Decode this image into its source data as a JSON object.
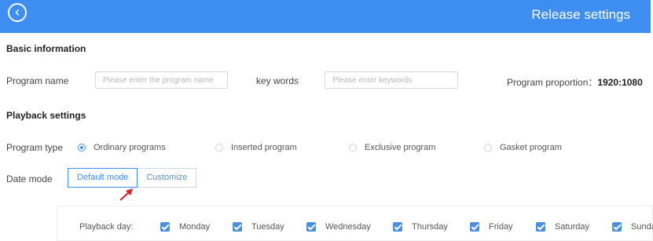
{
  "header": {
    "title": "Release settings",
    "back_icon": "‹",
    "background": "#3d8ef0"
  },
  "basic": {
    "section_title": "Basic information",
    "program_name_label": "Program name",
    "program_name_placeholder": "Please enter the program name",
    "keywords_label": "key words",
    "keywords_placeholder": "Please enter keywords",
    "proportion_label": "Program proportion：",
    "proportion_value": "1920:1080"
  },
  "playback": {
    "section_title": "Playback settings",
    "program_type_label": "Program type",
    "program_types": [
      {
        "label": "Ordinary programs",
        "checked": true
      },
      {
        "label": "Inserted program",
        "checked": false
      },
      {
        "label": "Exclusive program",
        "checked": false
      },
      {
        "label": "Gasket program",
        "checked": false
      }
    ],
    "date_mode_label": "Date mode",
    "date_modes": [
      {
        "label": "Default mode",
        "active": true
      },
      {
        "label": "Customize",
        "active": false
      }
    ],
    "playback_day_label": "Playback day:",
    "days": [
      {
        "label": "Monday",
        "checked": true
      },
      {
        "label": "Tuesday",
        "checked": true
      },
      {
        "label": "Wednesday",
        "checked": true
      },
      {
        "label": "Thursday",
        "checked": true
      },
      {
        "label": "Friday",
        "checked": true
      },
      {
        "label": "Saturday",
        "checked": true
      },
      {
        "label": "Sunda",
        "checked": true
      }
    ]
  },
  "annotation": {
    "arrow_color": "#e02020"
  }
}
